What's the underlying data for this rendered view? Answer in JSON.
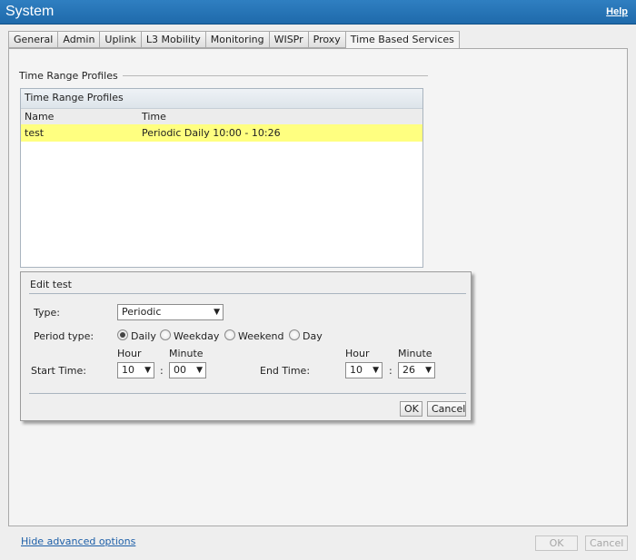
{
  "window": {
    "title": "System",
    "help_label": "Help"
  },
  "tabs": [
    {
      "label": "General"
    },
    {
      "label": "Admin"
    },
    {
      "label": "Uplink"
    },
    {
      "label": "L3 Mobility"
    },
    {
      "label": "Monitoring"
    },
    {
      "label": "WISPr"
    },
    {
      "label": "Proxy"
    },
    {
      "label": "Time Based Services",
      "active": true
    }
  ],
  "section": {
    "title": "Time Range Profiles"
  },
  "profiles_table": {
    "title": "Time Range Profiles",
    "columns": [
      "Name",
      "Time"
    ],
    "rows": [
      {
        "name": "test",
        "time": "Periodic Daily 10:00 - 10:26",
        "selected": true
      }
    ]
  },
  "edit": {
    "title": "Edit test",
    "type_label": "Type:",
    "type_value": "Periodic",
    "period_type_label": "Period type:",
    "period_options": [
      "Daily",
      "Weekday",
      "Weekend",
      "Day"
    ],
    "period_selected": "Daily",
    "hour_label": "Hour",
    "minute_label": "Minute",
    "start_label": "Start Time:",
    "start_hour": "10",
    "start_minute": "00",
    "end_label": "End Time:",
    "end_hour": "10",
    "end_minute": "26",
    "colon": ":",
    "ok_label": "OK",
    "cancel_label": "Cancel"
  },
  "footer": {
    "hide_advanced_label": "Hide advanced options",
    "ok_label": "OK",
    "cancel_label": "Cancel"
  },
  "colors": {
    "titlebar": "#1f6aab",
    "selected_row": "#ffff80",
    "link": "#1d5fa8"
  }
}
